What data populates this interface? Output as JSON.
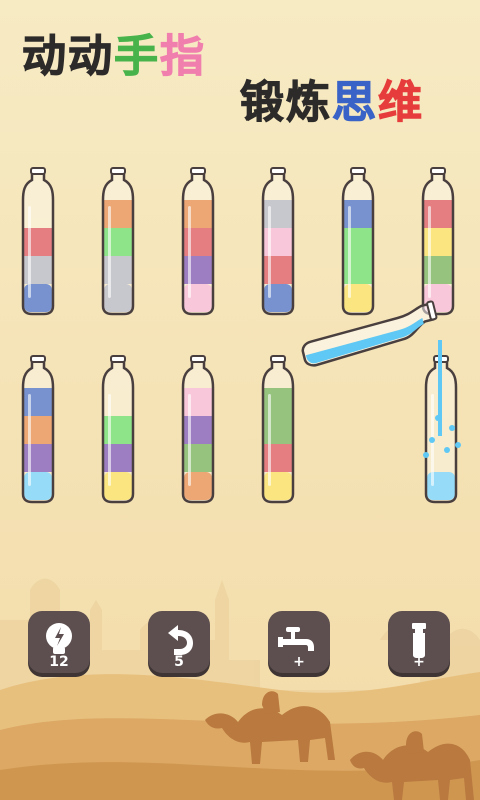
{
  "headline": {
    "line1": [
      {
        "text": "动动",
        "color": "#2d2a2a"
      },
      {
        "text": "手",
        "color": "#47b34a"
      },
      {
        "text": "指",
        "color": "#f07fae"
      }
    ],
    "line2": [
      {
        "text": "锻炼",
        "color": "#2d2a2a"
      },
      {
        "text": "思",
        "color": "#3a63c7"
      },
      {
        "text": "维",
        "color": "#e63c3c"
      }
    ]
  },
  "palette": {
    "red": "#d63a3d",
    "gray": "#a9a9b4",
    "blue": "#2e58b6",
    "orange": "#e2782a",
    "green": "#52d84a",
    "purple": "#6a3aa3",
    "pink": "#f6a9c7",
    "yellow": "#f8d83c",
    "olive": "#5ea43a",
    "lightblue": "#5fc8f4"
  },
  "bottles": [
    {
      "layers": [
        "blue",
        "gray",
        "red"
      ]
    },
    {
      "layers": [
        "gray",
        "gray",
        "green",
        "orange"
      ]
    },
    {
      "layers": [
        "pink",
        "purple",
        "red",
        "orange"
      ]
    },
    {
      "layers": [
        "blue",
        "red",
        "pink",
        "gray"
      ]
    },
    {
      "layers": [
        "yellow",
        "green",
        "green",
        "blue"
      ]
    },
    {
      "layers": [
        "pink",
        "olive",
        "yellow",
        "red"
      ]
    },
    {
      "layers": [
        "lightblue",
        "purple",
        "orange",
        "blue"
      ]
    },
    {
      "layers": [
        "yellow",
        "purple",
        "green"
      ]
    },
    {
      "layers": [
        "orange",
        "olive",
        "purple",
        "pink"
      ]
    },
    {
      "layers": [
        "yellow",
        "red",
        "olive",
        "olive"
      ]
    },
    {
      "layers": [
        "lightblue"
      ]
    }
  ],
  "pouring_bottle": {
    "liquid": "lightblue"
  },
  "powerups": [
    {
      "name": "hint",
      "icon": "lightbulb-icon",
      "badge": "12"
    },
    {
      "name": "undo",
      "icon": "undo-icon",
      "badge": "5"
    },
    {
      "name": "faucet",
      "icon": "faucet-icon",
      "badge": "+"
    },
    {
      "name": "add-bottle",
      "icon": "add-bottle-icon",
      "badge": "+"
    }
  ]
}
